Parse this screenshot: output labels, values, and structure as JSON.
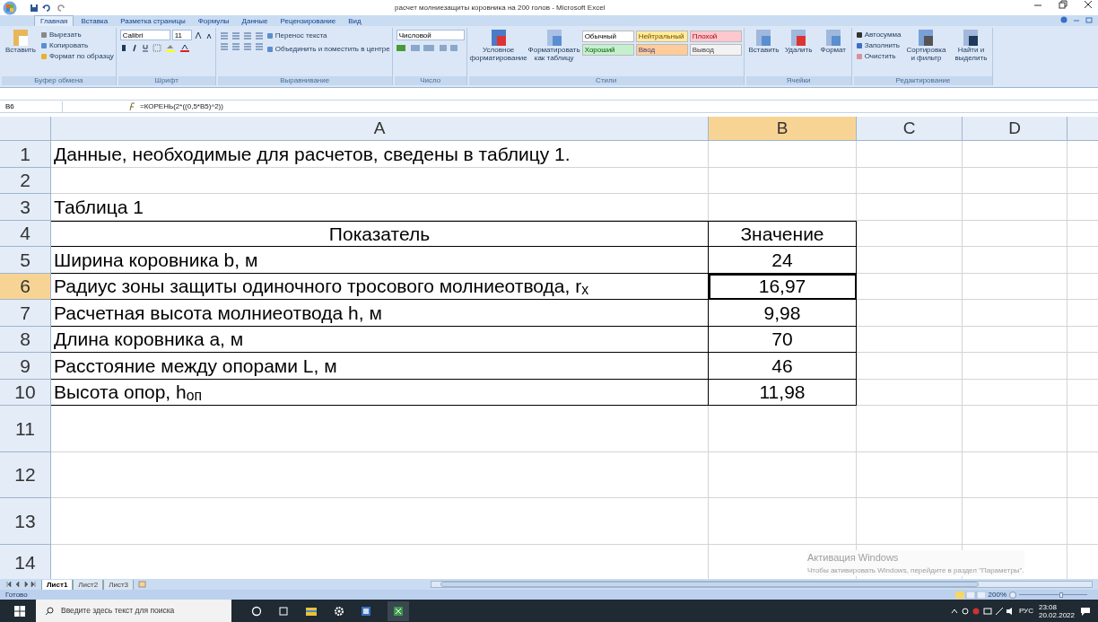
{
  "window": {
    "title": "расчет молниезащиты коровника на 200 голов - Microsoft Excel"
  },
  "tabs": [
    {
      "label": "Главная",
      "selected": true
    },
    {
      "label": "Вставка",
      "selected": false
    },
    {
      "label": "Разметка страницы",
      "selected": false
    },
    {
      "label": "Формулы",
      "selected": false
    },
    {
      "label": "Данные",
      "selected": false
    },
    {
      "label": "Рецензирование",
      "selected": false
    },
    {
      "label": "Вид",
      "selected": false
    }
  ],
  "ribbon": {
    "clipboard": {
      "paste": "Вставить",
      "items": [
        "Вырезать",
        "Копировать",
        "Формат по образцу"
      ],
      "label": "Буфер обмена"
    },
    "font": {
      "name": "Calibri",
      "size": "11",
      "label": "Шрифт"
    },
    "alignment": {
      "wrap": "Перенос текста",
      "merge": "Объединить и поместить в центре",
      "label": "Выравнивание"
    },
    "number": {
      "format": "Числовой",
      "label": "Число"
    },
    "styles": {
      "conditional": "Условное форматирование",
      "as_table": "Форматировать как таблицу",
      "cells": [
        {
          "label": "Обычный",
          "color": "#ffffff"
        },
        {
          "label": "Нейтральный",
          "color": "#ffeb9c"
        },
        {
          "label": "Плохой",
          "color": "#ffc7ce"
        },
        {
          "label": "Хороший",
          "color": "#c6efce"
        },
        {
          "label": "Ввод",
          "color": "#ffcc99"
        },
        {
          "label": "Вывод",
          "color": "#f2f2f2"
        }
      ],
      "label": "Стили"
    },
    "cells": {
      "buttons": [
        "Вставить",
        "Удалить",
        "Формат"
      ],
      "label": "Ячейки"
    },
    "editing": {
      "items": [
        "Автосумма",
        "Заполнить",
        "Очистить"
      ],
      "sort": "Сортировка и фильтр",
      "find": "Найти и выделить",
      "label": "Редактирование"
    }
  },
  "formula_bar": {
    "cell_ref": "B6",
    "formula": "=КОРЕНЬ(2*((0,5*B5)^2))"
  },
  "columns": [
    {
      "label": "A",
      "selected": false
    },
    {
      "label": "B",
      "selected": true
    },
    {
      "label": "C",
      "selected": false
    },
    {
      "label": "D",
      "selected": false
    }
  ],
  "rows": [
    {
      "number": "1",
      "selected": false,
      "a": "Данные, необходимые для расчетов, сведены в таблицу 1."
    },
    {
      "number": "2",
      "selected": false
    },
    {
      "number": "3",
      "selected": false,
      "a": "Таблица 1"
    },
    {
      "number": "4",
      "selected": false,
      "a": "Показатель",
      "b": "Значение",
      "kind": "header"
    },
    {
      "number": "5",
      "selected": false,
      "a": "Ширина коровника b, м",
      "b": "24",
      "kind": "table"
    },
    {
      "number": "6",
      "selected": true,
      "a": "Радиус зоны защиты одиночного тросового молниеотвода, r$_{x}$",
      "b": "16,97",
      "kind": "table"
    },
    {
      "number": "7",
      "selected": false,
      "a": "Расчетная высота молниеотвода h, м",
      "b": "9,98",
      "kind": "table"
    },
    {
      "number": "8",
      "selected": false,
      "a": "Длина коровника а, м",
      "b": "70",
      "kind": "table"
    },
    {
      "number": "9",
      "selected": false,
      "a": "Расстояние между опорами L, м",
      "b": "46",
      "kind": "table"
    },
    {
      "number": "10",
      "selected": false,
      "a": "Высота опор, h$_{оп}$",
      "b": "11,98",
      "kind": "table"
    },
    {
      "number": "11",
      "selected": false
    },
    {
      "number": "12",
      "selected": false
    },
    {
      "number": "13",
      "selected": false
    },
    {
      "number": "14",
      "selected": false
    }
  ],
  "activation": {
    "title": "Активация Windows",
    "text": "Чтобы активировать Windows, перейдите в раздел \"Параметры\"."
  },
  "sheet_tabs": [
    {
      "label": "Лист1",
      "selected": true
    },
    {
      "label": "Лист2",
      "selected": false
    },
    {
      "label": "Лист3",
      "selected": false
    }
  ],
  "status_bar": {
    "text": "Готово",
    "zoom": "200%",
    "zoom_slider": {
      "level": 0.62
    }
  },
  "taskbar": {
    "search_placeholder": "Введите здесь текст для поиска",
    "language": "РУС",
    "time": "23:08",
    "date": "20.02.2022"
  }
}
